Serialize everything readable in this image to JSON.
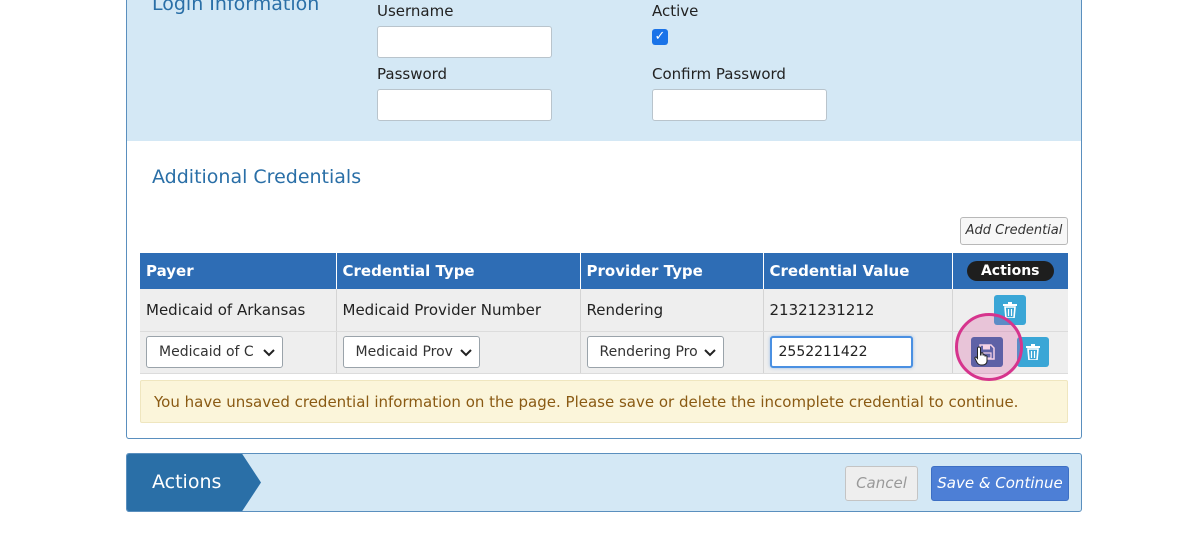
{
  "login": {
    "title": "Login Information",
    "username_label": "Username",
    "username_value": "",
    "active_label": "Active",
    "active_checked": true,
    "password_label": "Password",
    "password_value": "",
    "confirm_password_label": "Confirm Password",
    "confirm_password_value": ""
  },
  "credentials": {
    "title": "Additional Credentials",
    "add_button": "Add Credential",
    "columns": [
      "Payer",
      "Credential Type",
      "Provider Type",
      "Credential Value",
      "Actions"
    ],
    "rows": [
      {
        "payer": "Medicaid of Arkansas",
        "credential_type": "Medicaid Provider Number",
        "provider_type": "Rendering",
        "credential_value": "21321231212"
      }
    ],
    "edit_row": {
      "payer_select": "Medicaid of C",
      "credential_type_select": "Medicaid Prov",
      "provider_type_select": "Rendering Pro",
      "credential_value_input": "2552211422"
    },
    "warning": "You have unsaved credential information on the page. Please save or delete the incomplete credential to continue."
  },
  "actions_bar": {
    "tab_label": "Actions",
    "cancel_label": "Cancel",
    "save_label": "Save & Continue"
  },
  "icons": {
    "trash": "trash-icon",
    "save": "save-icon",
    "pointer": "hand-pointer-icon",
    "chevron": "chevron-down-icon"
  },
  "colors": {
    "primary": "#2a6fa7",
    "header_bg": "#2e6db5",
    "section_bg": "#d4e8f5",
    "warning_bg": "#fbf5da",
    "warning_text": "#8a5a13",
    "highlight": "#d6348d"
  }
}
